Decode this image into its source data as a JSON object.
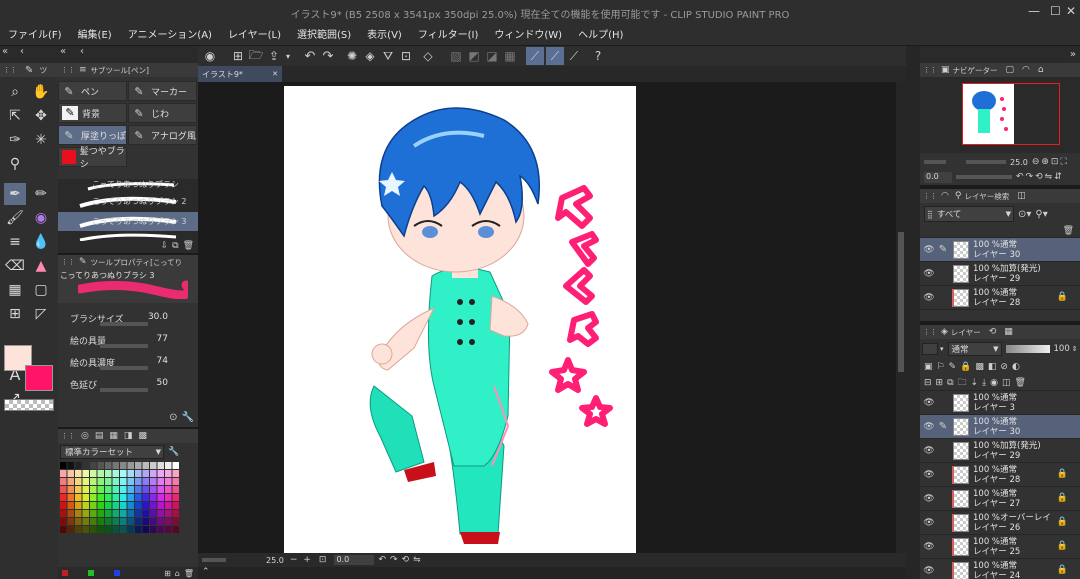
{
  "app": {
    "title": "イラスト9* (B5 2508 x 3541px 350dpi 25.0%)  現在全ての機能を使用可能です - CLIP STUDIO PAINT PRO",
    "window_controls": [
      "—",
      "☐",
      "✕"
    ]
  },
  "menu": [
    "ファイル(F)",
    "編集(E)",
    "アニメーション(A)",
    "レイヤー(L)",
    "選択範囲(S)",
    "表示(V)",
    "フィルター(I)",
    "ウィンドウ(W)",
    "ヘルプ(H)"
  ],
  "canvas_tab": {
    "label": "イラスト9*",
    "close": "✕"
  },
  "sub_tool": {
    "header": "サブツール[ペン]",
    "buttons": [
      "ペン",
      "マーカー",
      "背景",
      "じわ",
      "厚塗りっぽ",
      "アナログ風",
      "髪つやブラシ"
    ],
    "brushes": [
      "こってりあつぬりブラシ",
      "こってりあつぬりブラシ 2",
      "こってりあつぬりブラシ 3"
    ]
  },
  "tool_property": {
    "header": "ツールプロパティ[こってり",
    "preview_label": "こってりあつぬりブラシ 3",
    "rows": [
      {
        "label": "ブラシサイズ",
        "value": "30.0"
      },
      {
        "label": "絵の具量",
        "value": "77"
      },
      {
        "label": "絵の具濃度",
        "value": "74"
      },
      {
        "label": "色延び",
        "value": "50"
      }
    ]
  },
  "color_set": {
    "label": "標準カラーセット"
  },
  "colors": {
    "main": "#fde3d9",
    "sub": "#ff1467",
    "accent": "#5b6f95"
  },
  "status_bar": {
    "zoom": "25.0",
    "rotation": "0.0"
  },
  "navigator": {
    "header": "ナビゲーター",
    "zoom": "25.0",
    "rotation": "0.0"
  },
  "layer_search": {
    "header": "レイヤー検索",
    "filter": "すべて",
    "rows": [
      {
        "mode": "100 %通常",
        "name": "レイヤー 30",
        "selected": true
      },
      {
        "mode": "100 %加算(発光)",
        "name": "レイヤー 29"
      },
      {
        "mode": "100 %通常",
        "name": "レイヤー 28",
        "clip": true,
        "lock": true
      }
    ]
  },
  "layers": {
    "header": "レイヤー",
    "blend_mode": "通常",
    "opacity": "100",
    "rows": [
      {
        "mode": "100 %通常",
        "name": "レイヤー 3"
      },
      {
        "mode": "100 %通常",
        "name": "レイヤー 30",
        "selected": true
      },
      {
        "mode": "100 %加算(発光)",
        "name": "レイヤー 29"
      },
      {
        "mode": "100 %通常",
        "name": "レイヤー 28",
        "clip": true,
        "lock": true
      },
      {
        "mode": "100 %通常",
        "name": "レイヤー 27",
        "clip": true,
        "lock": true
      },
      {
        "mode": "100 %オーバーレイ",
        "name": "レイヤー 26",
        "clip": true,
        "lock": true
      },
      {
        "mode": "100 %通常",
        "name": "レイヤー 25",
        "clip": true,
        "lock": true
      },
      {
        "mode": "100 %通常",
        "name": "レイヤー 24",
        "clip": true,
        "lock": true
      }
    ]
  }
}
